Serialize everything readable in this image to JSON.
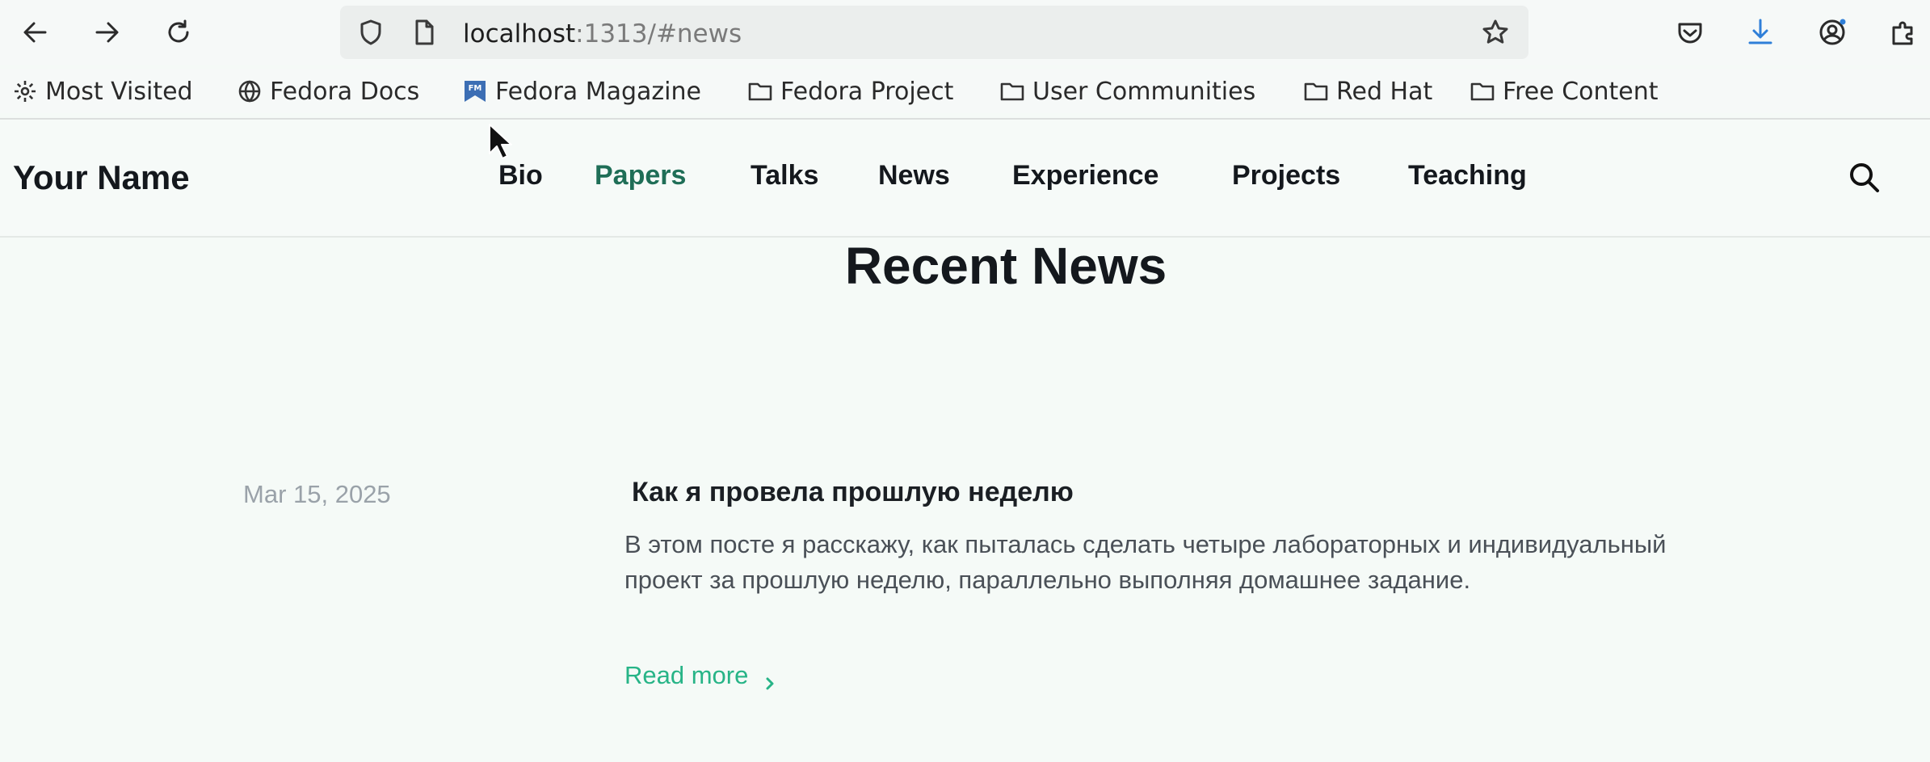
{
  "browser": {
    "url_host": "localhost",
    "url_rest": ":1313/#news",
    "bookmarks": [
      {
        "label": "Most Visited",
        "icon": "gear-icon"
      },
      {
        "label": "Fedora Docs",
        "icon": "globe-icon"
      },
      {
        "label": "Fedora Magazine",
        "icon": "fedora-magazine-icon"
      },
      {
        "label": "Fedora Project",
        "icon": "folder-icon"
      },
      {
        "label": "User Communities",
        "icon": "folder-icon"
      },
      {
        "label": "Red Hat",
        "icon": "folder-icon"
      },
      {
        "label": "Free Content",
        "icon": "folder-icon"
      }
    ],
    "fm_badge": "FM"
  },
  "site": {
    "brand": "Your Name",
    "nav": [
      {
        "label": "Bio"
      },
      {
        "label": "Papers",
        "active": true
      },
      {
        "label": "Talks"
      },
      {
        "label": "News"
      },
      {
        "label": "Experience"
      },
      {
        "label": "Projects"
      },
      {
        "label": "Teaching"
      }
    ]
  },
  "news": {
    "title": "Recent News",
    "items": [
      {
        "date": "Mar 15, 2025",
        "title": "Как я провела прошлую неделю",
        "summary": "В этом посте я расскажу, как пыталась сделать четыре лабораторных и индивидуальный проект за прошлую неделю, параллельно выполняя домашнее задание.",
        "read_more": "Read more"
      }
    ]
  },
  "colors": {
    "background": "#f5faf7",
    "accent": "#27b487",
    "active_nav": "#1f6e57",
    "date_text": "#9aa2a9"
  }
}
